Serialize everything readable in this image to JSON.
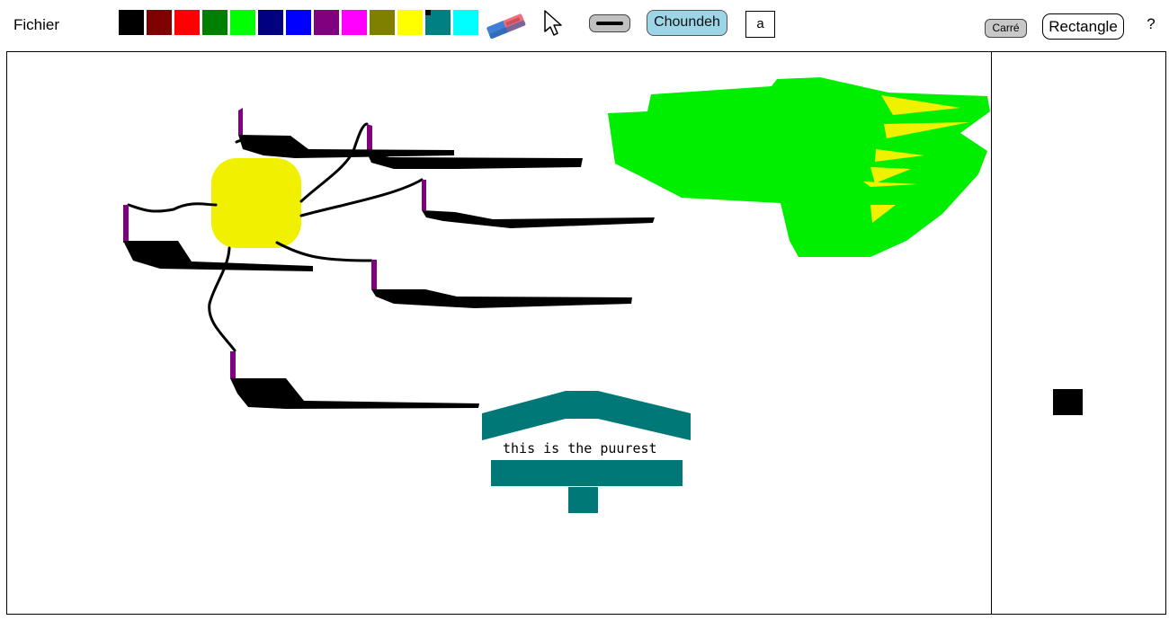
{
  "menu": {
    "file_label": "Fichier"
  },
  "palette": {
    "colors": [
      "#000000",
      "#800000",
      "#ff0000",
      "#008000",
      "#00ff00",
      "#000080",
      "#0000ff",
      "#800080",
      "#ff00ff",
      "#808000",
      "#ffff00",
      "#008080",
      "#00ffff"
    ],
    "selected_index": 11
  },
  "tools": {
    "eraser_icon": "eraser-icon",
    "pointer_icon": "arrow-pointer-icon",
    "line_icon": "line-icon",
    "choundeh_label": "Choundeh",
    "text_label": "a",
    "carre_label": "Carré",
    "rectangle_label": "Rectangle",
    "help_label": "?"
  },
  "canvas": {
    "text": "this is the puurest",
    "colors": {
      "ink": "#000000",
      "yellow": "#f0f000",
      "green": "#00ee00",
      "teal": "#007878",
      "purple": "#800080"
    }
  },
  "preview": {
    "color": "#000000"
  }
}
